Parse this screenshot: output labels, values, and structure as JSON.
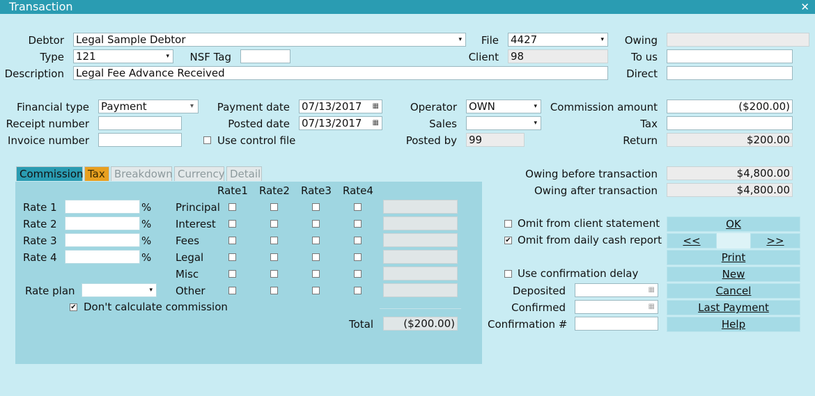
{
  "window": {
    "title": "Transaction",
    "close_symbol": "✕"
  },
  "header": {
    "debtor_label": "Debtor",
    "debtor_value": "Legal Sample Debtor",
    "type_label": "Type",
    "type_value": "121",
    "nsf_label": "NSF Tag",
    "nsf_value": "",
    "description_label": "Description",
    "description_value": "Legal Fee Advance Received",
    "file_label": "File",
    "file_value": "4427",
    "client_label": "Client",
    "client_value": "98",
    "owing_label": "Owing",
    "owing_value": "",
    "to_us_label": "To us",
    "to_us_value": "",
    "direct_label": "Direct",
    "direct_value": ""
  },
  "financial": {
    "financial_type_label": "Financial type",
    "financial_type_value": "Payment",
    "receipt_label": "Receipt number",
    "receipt_value": "",
    "invoice_label": "Invoice number",
    "invoice_value": "",
    "payment_date_label": "Payment date",
    "payment_date_value": "07/13/2017",
    "posted_date_label": "Posted date",
    "posted_date_value": "07/13/2017",
    "use_control_label": "Use control file",
    "use_control_checked": false,
    "operator_label": "Operator",
    "operator_value": "OWN",
    "sales_label": "Sales",
    "sales_value": "",
    "posted_by_label": "Posted by",
    "posted_by_value": "99",
    "commission_amount_label": "Commission amount",
    "commission_amount_value": "($200.00)",
    "tax_label": "Tax",
    "tax_value": "",
    "return_label": "Return",
    "return_value": "$200.00"
  },
  "tabs": [
    {
      "label": "Commission",
      "state": "active"
    },
    {
      "label": "Tax",
      "state": "tax"
    },
    {
      "label": "Breakdown",
      "state": "inactive"
    },
    {
      "label": "Currency",
      "state": "inactive"
    },
    {
      "label": "Detail",
      "state": "inactive"
    }
  ],
  "commission": {
    "rate_cols": [
      "Rate1",
      "Rate2",
      "Rate3",
      "Rate4"
    ],
    "rates": [
      {
        "label": "Rate 1",
        "value": "",
        "pct": "%"
      },
      {
        "label": "Rate 2",
        "value": "",
        "pct": "%"
      },
      {
        "label": "Rate 3",
        "value": "",
        "pct": "%"
      },
      {
        "label": "Rate 4",
        "value": "",
        "pct": "%"
      }
    ],
    "rows": [
      "Principal",
      "Interest",
      "Fees",
      "Legal",
      "Misc",
      "Other"
    ],
    "rate_plan_label": "Rate plan",
    "rate_plan_value": "",
    "dont_calc_label": "Don't calculate commission",
    "dont_calc_checked": true,
    "total_label": "Total",
    "total_value": "($200.00)"
  },
  "summary": {
    "owing_before_label": "Owing before transaction",
    "owing_before_value": "$4,800.00",
    "owing_after_label": "Owing after transaction",
    "owing_after_value": "$4,800.00"
  },
  "options": {
    "omit_client_label": "Omit from client statement",
    "omit_client_checked": false,
    "omit_cash_label": "Omit from daily cash report",
    "omit_cash_checked": true,
    "use_confirmation_label": "Use confirmation delay",
    "use_confirmation_checked": false,
    "deposited_label": "Deposited",
    "deposited_value": "",
    "confirmed_label": "Confirmed",
    "confirmed_value": "",
    "confirmation_no_label": "Confirmation #",
    "confirmation_no_value": ""
  },
  "buttons": {
    "ok": "OK",
    "prev": "<<",
    "next": ">>",
    "print": "Print",
    "new": "New",
    "cancel": "Cancel",
    "last_payment": "Last Payment",
    "help": "Help"
  },
  "icons": {
    "dropdown": "▾",
    "calendar": "▦",
    "check": "✔"
  }
}
